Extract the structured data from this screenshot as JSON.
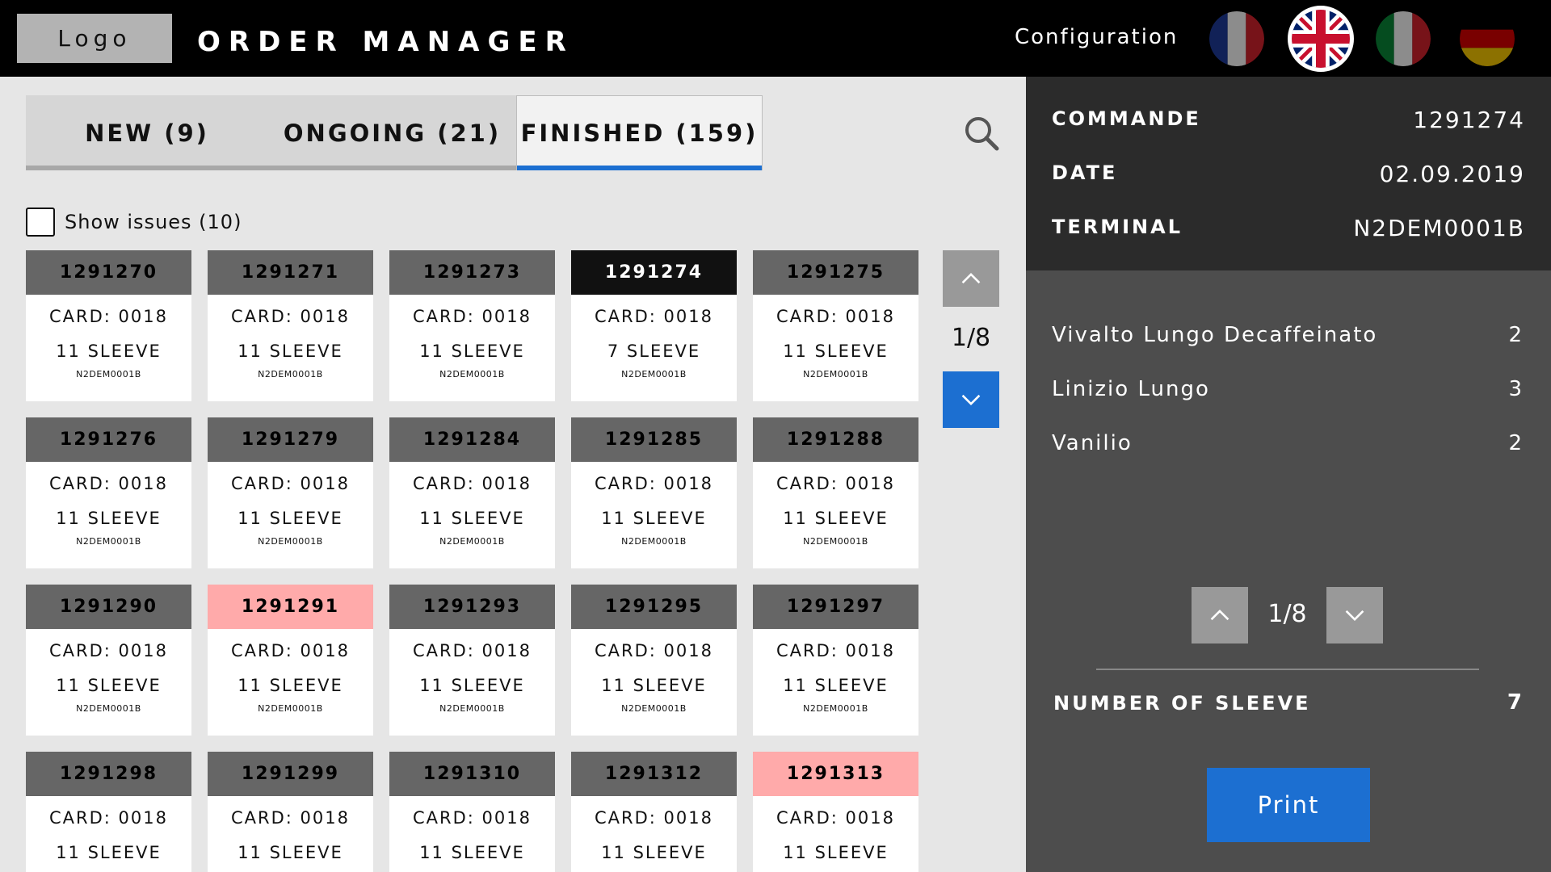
{
  "header": {
    "logo_label": "Logo",
    "title": "ORDER MANAGER",
    "config_label": "Configuration",
    "languages": [
      "French",
      "English",
      "Italian",
      "German"
    ],
    "active_language": "English"
  },
  "tabs": [
    {
      "label": "NEW (9)",
      "active": false
    },
    {
      "label": "ONGOING (21)",
      "active": false
    },
    {
      "label": "FINISHED (159)",
      "active": true
    }
  ],
  "filters": {
    "show_issues_label": "Show issues (10)",
    "show_issues_checked": false
  },
  "orders": [
    {
      "id": "1291270",
      "card": "CARD: 0018",
      "sleeves": "11 SLEEVE",
      "terminal": "N2DEM0001B",
      "state": "normal"
    },
    {
      "id": "1291271",
      "card": "CARD: 0018",
      "sleeves": "11 SLEEVE",
      "terminal": "N2DEM0001B",
      "state": "normal"
    },
    {
      "id": "1291273",
      "card": "CARD: 0018",
      "sleeves": "11 SLEEVE",
      "terminal": "N2DEM0001B",
      "state": "normal"
    },
    {
      "id": "1291274",
      "card": "CARD: 0018",
      "sleeves": "7 SLEEVE",
      "terminal": "N2DEM0001B",
      "state": "selected"
    },
    {
      "id": "1291275",
      "card": "CARD: 0018",
      "sleeves": "11 SLEEVE",
      "terminal": "N2DEM0001B",
      "state": "normal"
    },
    {
      "id": "1291276",
      "card": "CARD: 0018",
      "sleeves": "11 SLEEVE",
      "terminal": "N2DEM0001B",
      "state": "normal"
    },
    {
      "id": "1291279",
      "card": "CARD: 0018",
      "sleeves": "11 SLEEVE",
      "terminal": "N2DEM0001B",
      "state": "normal"
    },
    {
      "id": "1291284",
      "card": "CARD: 0018",
      "sleeves": "11 SLEEVE",
      "terminal": "N2DEM0001B",
      "state": "normal"
    },
    {
      "id": "1291285",
      "card": "CARD: 0018",
      "sleeves": "11 SLEEVE",
      "terminal": "N2DEM0001B",
      "state": "normal"
    },
    {
      "id": "1291288",
      "card": "CARD: 0018",
      "sleeves": "11 SLEEVE",
      "terminal": "N2DEM0001B",
      "state": "normal"
    },
    {
      "id": "1291290",
      "card": "CARD: 0018",
      "sleeves": "11 SLEEVE",
      "terminal": "N2DEM0001B",
      "state": "normal"
    },
    {
      "id": "1291291",
      "card": "CARD: 0018",
      "sleeves": "11 SLEEVE",
      "terminal": "N2DEM0001B",
      "state": "issue"
    },
    {
      "id": "1291293",
      "card": "CARD: 0018",
      "sleeves": "11 SLEEVE",
      "terminal": "N2DEM0001B",
      "state": "normal"
    },
    {
      "id": "1291295",
      "card": "CARD: 0018",
      "sleeves": "11 SLEEVE",
      "terminal": "N2DEM0001B",
      "state": "normal"
    },
    {
      "id": "1291297",
      "card": "CARD: 0018",
      "sleeves": "11 SLEEVE",
      "terminal": "N2DEM0001B",
      "state": "normal"
    },
    {
      "id": "1291298",
      "card": "CARD: 0018",
      "sleeves": "11 SLEEVE",
      "terminal": "",
      "state": "normal"
    },
    {
      "id": "1291299",
      "card": "CARD: 0018",
      "sleeves": "11 SLEEVE",
      "terminal": "",
      "state": "normal"
    },
    {
      "id": "1291310",
      "card": "CARD: 0018",
      "sleeves": "11 SLEEVE",
      "terminal": "",
      "state": "normal"
    },
    {
      "id": "1291312",
      "card": "CARD: 0018",
      "sleeves": "11 SLEEVE",
      "terminal": "",
      "state": "normal"
    },
    {
      "id": "1291313",
      "card": "CARD: 0018",
      "sleeves": "11 SLEEVE",
      "terminal": "",
      "state": "issue"
    }
  ],
  "grid_pagination": {
    "label": "1/8"
  },
  "detail": {
    "commande_label": "COMMANDE",
    "commande_value": "1291274",
    "date_label": "DATE",
    "date_value": "02.09.2019",
    "terminal_label": "TERMINAL",
    "terminal_value": "N2DEM0001B",
    "products": [
      {
        "name": "Vivalto Lungo Decaffeinato",
        "qty": "2"
      },
      {
        "name": "Linizio Lungo",
        "qty": "3"
      },
      {
        "name": "Vanilio",
        "qty": "2"
      }
    ],
    "pagination_label": "1/8",
    "sleeve_label": "NUMBER OF SLEEVE",
    "sleeve_value": "7",
    "print_label": "Print"
  },
  "colors": {
    "accent": "#1c6fd1",
    "header_bg": "#000000",
    "card_header": "#666666",
    "card_selected": "#111111",
    "card_issue": "#ffaaaa",
    "detail_bg": "#4d4d4d",
    "detail_info_bg": "#2b2b2b"
  },
  "icons": {
    "search": "search-icon",
    "page_up": "chevron-up-icon",
    "page_down": "chevron-down-icon"
  }
}
